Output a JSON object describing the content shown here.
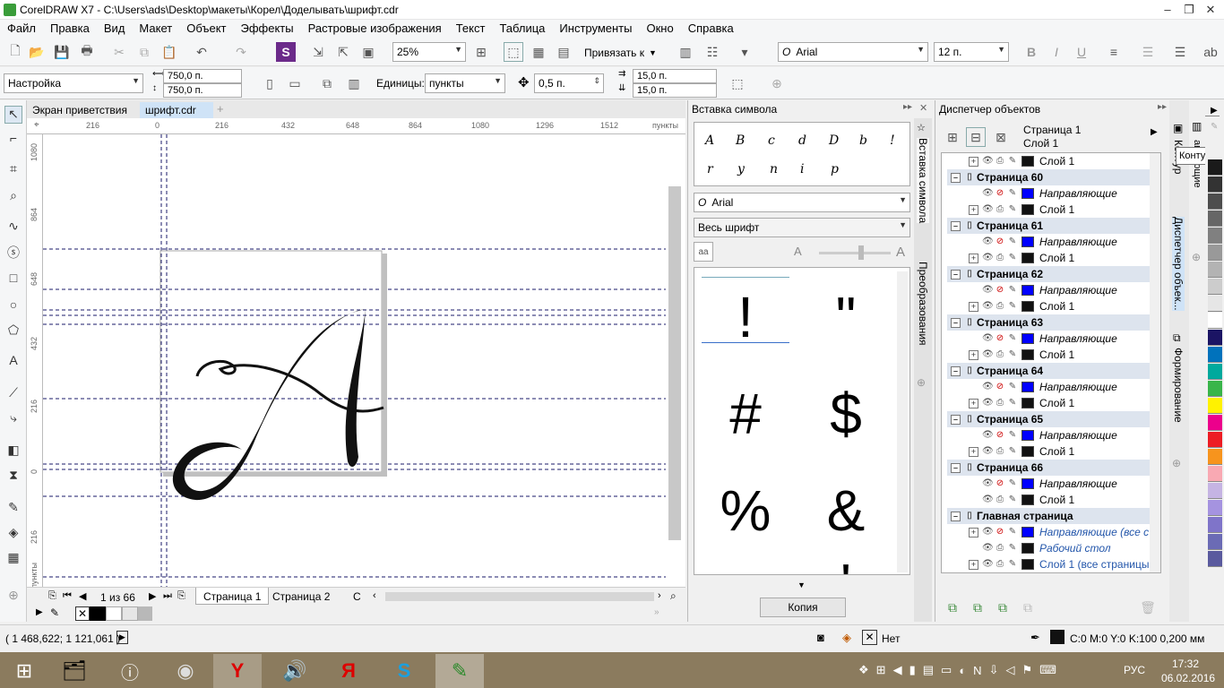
{
  "window": {
    "title": "CorelDRAW X7 - C:\\Users\\ads\\Desktop\\макеты\\Корел\\Доделывать\\шрифт.cdr",
    "minimize": "–",
    "restore": "❐",
    "close": "✕"
  },
  "menu": [
    "Файл",
    "Правка",
    "Вид",
    "Макет",
    "Объект",
    "Эффекты",
    "Растровые изображения",
    "Текст",
    "Таблица",
    "Инструменты",
    "Окно",
    "Справка"
  ],
  "toolbar": {
    "zoom": "25%",
    "snap_label": "Привязать к",
    "font": "Arial",
    "font_size": "12 п."
  },
  "propbar": {
    "preset": "Настройка",
    "width": "750,0 п.",
    "height": "750,0 п.",
    "units_label": "Единицы:",
    "units": "пункты",
    "nudge": "0,5 п.",
    "dup_x": "15,0 п.",
    "dup_y": "15,0 п."
  },
  "doc_tabs": [
    "Экран приветствия",
    "шрифт.cdr"
  ],
  "ruler_h": [
    "216",
    "0",
    "216",
    "432",
    "648",
    "864",
    "1080",
    "1296",
    "1512",
    "пункты"
  ],
  "ruler_v": [
    "1080",
    "864",
    "648",
    "432",
    "216",
    "0",
    "216",
    "пункты"
  ],
  "page_nav": {
    "counter": "1 из 66",
    "tabs": [
      "Страница 1",
      "Страница 2",
      "С"
    ]
  },
  "insert_symbol": {
    "title": "Вставка символа",
    "font": "Arial",
    "subset": "Весь шрифт",
    "recent_glyphs": [
      "A",
      "B",
      "c",
      "d",
      "D",
      "b",
      "!",
      "r",
      "y",
      "n",
      "i",
      "p"
    ],
    "glyphs": [
      "!",
      "\"",
      "#",
      "$",
      "%",
      "&",
      "'"
    ],
    "copy_button": "Копия",
    "side_tabs": [
      "Вставка символа",
      "Преобразования"
    ]
  },
  "object_manager": {
    "title": "Диспетчер объектов",
    "page": "Страница 1",
    "layer": "Слой 1",
    "tooltip": "Контур",
    "side_tabs": [
      "Диспетчер объек...",
      "Формирование"
    ],
    "rows": [
      {
        "type": "layer",
        "label": "Слой 1",
        "color": "#111111",
        "exp": true,
        "italic": false
      },
      {
        "type": "page",
        "label": "Страница 60"
      },
      {
        "type": "layer",
        "label": "Направляющие",
        "color": "#0000ff",
        "exp": false,
        "italic": true
      },
      {
        "type": "layer",
        "label": "Слой 1",
        "color": "#111111",
        "exp": true,
        "italic": false
      },
      {
        "type": "page",
        "label": "Страница 61"
      },
      {
        "type": "layer",
        "label": "Направляющие",
        "color": "#0000ff",
        "exp": false,
        "italic": true
      },
      {
        "type": "layer",
        "label": "Слой 1",
        "color": "#111111",
        "exp": true,
        "italic": false
      },
      {
        "type": "page",
        "label": "Страница 62"
      },
      {
        "type": "layer",
        "label": "Направляющие",
        "color": "#0000ff",
        "exp": false,
        "italic": true
      },
      {
        "type": "layer",
        "label": "Слой 1",
        "color": "#111111",
        "exp": true,
        "italic": false
      },
      {
        "type": "page",
        "label": "Страница 63"
      },
      {
        "type": "layer",
        "label": "Направляющие",
        "color": "#0000ff",
        "exp": false,
        "italic": true
      },
      {
        "type": "layer",
        "label": "Слой 1",
        "color": "#111111",
        "exp": true,
        "italic": false
      },
      {
        "type": "page",
        "label": "Страница 64"
      },
      {
        "type": "layer",
        "label": "Направляющие",
        "color": "#0000ff",
        "exp": false,
        "italic": true
      },
      {
        "type": "layer",
        "label": "Слой 1",
        "color": "#111111",
        "exp": true,
        "italic": false
      },
      {
        "type": "page",
        "label": "Страница 65"
      },
      {
        "type": "layer",
        "label": "Направляющие",
        "color": "#0000ff",
        "exp": false,
        "italic": true
      },
      {
        "type": "layer",
        "label": "Слой 1",
        "color": "#111111",
        "exp": true,
        "italic": false
      },
      {
        "type": "page",
        "label": "Страница 66"
      },
      {
        "type": "layer",
        "label": "Направляющие",
        "color": "#0000ff",
        "exp": false,
        "italic": true
      },
      {
        "type": "layer",
        "label": "Слой 1",
        "color": "#111111",
        "exp": false,
        "italic": false
      },
      {
        "type": "page",
        "label": "Главная страница"
      },
      {
        "type": "layer",
        "label": "Направляющие (все с",
        "color": "#0000ff",
        "exp": true,
        "italic": true,
        "blue": true
      },
      {
        "type": "layer",
        "label": "Рабочий стол",
        "color": "#111111",
        "exp": false,
        "italic": true,
        "blue": true
      },
      {
        "type": "layer",
        "label": "Слой 1 (все страницы",
        "color": "#111111",
        "exp": true,
        "italic": false,
        "blue": true
      }
    ]
  },
  "palette": [
    "#1a1a1a",
    "#333333",
    "#4d4d4d",
    "#666666",
    "#808080",
    "#999999",
    "#b3b3b3",
    "#cccccc",
    "#e6e6e6",
    "#ffffff",
    "#1b1464",
    "#0072bc",
    "#00a99d",
    "#39b54a",
    "#fff200",
    "#ec008c",
    "#ed1c24",
    "#f7941d",
    "#f9a9b3",
    "#c5b4e3",
    "#a593e0",
    "#7f74c9",
    "#6b6bb5",
    "#5a5a9e"
  ],
  "status": {
    "coords": "( 1 468,622; 1 121,061 )",
    "fill_none": "Нет",
    "outline": "C:0 M:0 Y:0 K:100  0,200 мм"
  },
  "taskbar": {
    "lang": "РУС",
    "time": "17:32",
    "date": "06.02.2016"
  }
}
